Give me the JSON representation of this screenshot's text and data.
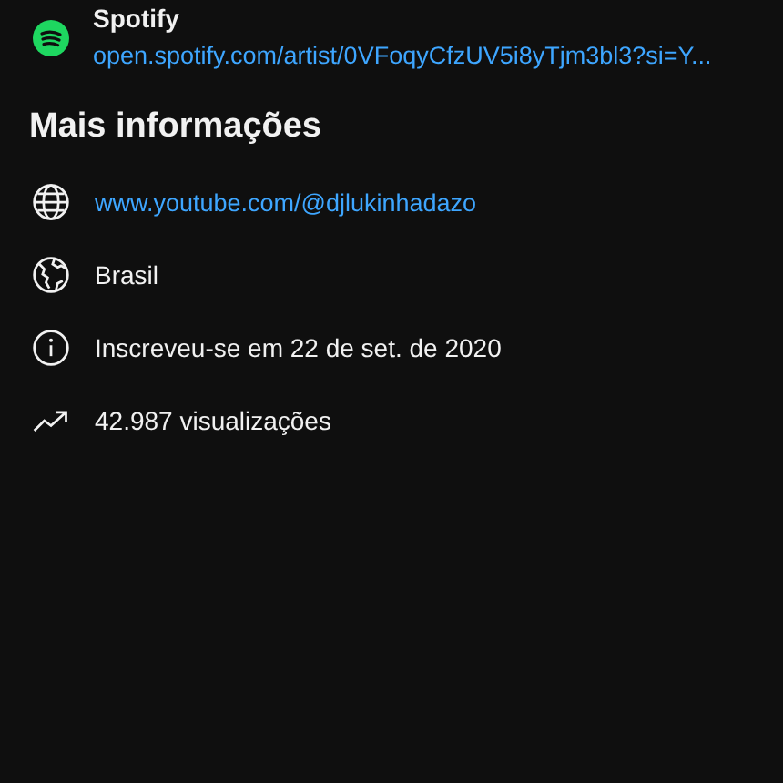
{
  "link": {
    "title": "Spotify",
    "url": "open.spotify.com/artist/0VFoqyCfzUV5i8yTjm3bl3?si=Y..."
  },
  "more_info": {
    "heading": "Mais informações",
    "items": [
      {
        "kind": "website",
        "text": "www.youtube.com/@djlukinhadazo"
      },
      {
        "kind": "country",
        "text": "Brasil"
      },
      {
        "kind": "joined",
        "text": "Inscreveu-se em 22 de set. de 2020"
      },
      {
        "kind": "views",
        "text": "42.987 visualizações"
      }
    ]
  }
}
